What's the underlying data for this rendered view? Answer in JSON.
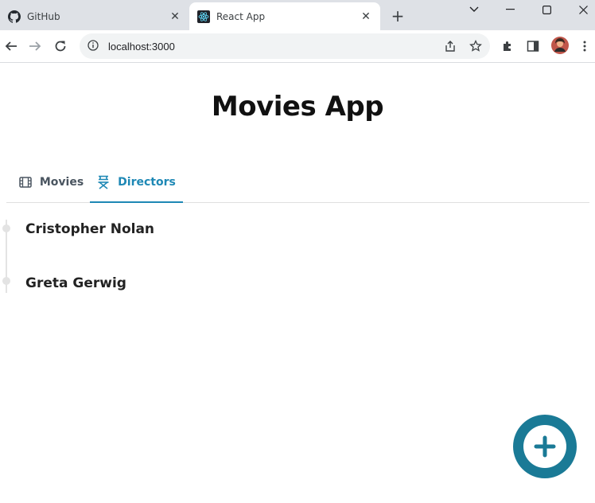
{
  "browser": {
    "tabs": [
      {
        "title": "GitHub",
        "favicon": "github-icon"
      },
      {
        "title": "React App",
        "favicon": "react-icon"
      }
    ],
    "url": "localhost:3000"
  },
  "app": {
    "title": "Movies App",
    "tabs": [
      {
        "label": "Movies",
        "icon": "film-icon"
      },
      {
        "label": "Directors",
        "icon": "director-chair-icon"
      }
    ],
    "active_tab": "Directors",
    "directors": [
      {
        "name": "Cristopher Nolan"
      },
      {
        "name": "Greta Gerwig"
      }
    ],
    "accent_color": "#1e88b5",
    "fab_color": "#1a7a96",
    "fab_icon": "plus-icon"
  }
}
